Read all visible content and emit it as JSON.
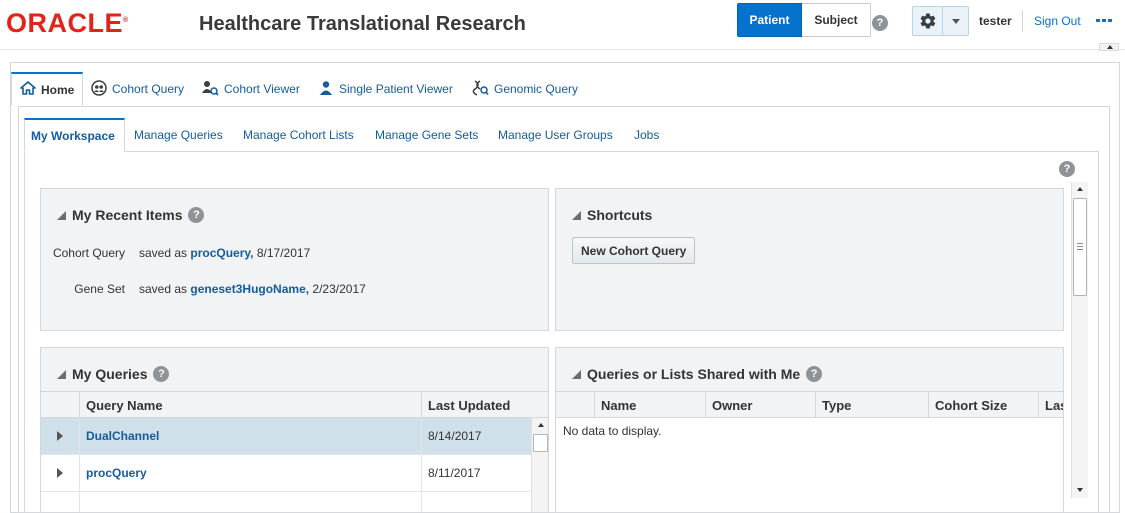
{
  "header": {
    "logo": "ORACLE",
    "title": "Healthcare Translational Research",
    "mode_patient": "Patient",
    "mode_subject": "Subject",
    "help": "?",
    "user": "tester",
    "sign_out": "Sign Out",
    "active_mode": "Patient"
  },
  "primary_tabs": [
    {
      "label": "Home",
      "icon": "home-icon",
      "active": true
    },
    {
      "label": "Cohort Query",
      "icon": "cohort-query-icon"
    },
    {
      "label": "Cohort Viewer",
      "icon": "cohort-viewer-icon"
    },
    {
      "label": "Single Patient Viewer",
      "icon": "single-patient-icon"
    },
    {
      "label": "Genomic Query",
      "icon": "genomic-query-icon"
    }
  ],
  "secondary_tabs": [
    {
      "label": "My Workspace",
      "active": true
    },
    {
      "label": "Manage Queries"
    },
    {
      "label": "Manage Cohort Lists"
    },
    {
      "label": "Manage Gene Sets"
    },
    {
      "label": "Manage User Groups"
    },
    {
      "label": "Jobs"
    }
  ],
  "recent_items": {
    "title": "My Recent Items",
    "rows": [
      {
        "type": "Cohort Query",
        "prefix": "saved as",
        "name": "procQuery,",
        "date": "8/17/2017"
      },
      {
        "type": "Gene Set",
        "prefix": "saved as",
        "name": "geneset3HugoName,",
        "date": "2/23/2017"
      }
    ]
  },
  "shortcuts": {
    "title": "Shortcuts",
    "new_cohort_query": "New Cohort Query"
  },
  "my_queries": {
    "title": "My Queries",
    "columns": [
      "Query Name",
      "Last Updated"
    ],
    "rows": [
      {
        "name": "DualChannel",
        "updated": "8/14/2017",
        "selected": true
      },
      {
        "name": "procQuery",
        "updated": "8/11/2017"
      }
    ]
  },
  "shared": {
    "title": "Queries or Lists Shared with Me",
    "columns": [
      "Name",
      "Owner",
      "Type",
      "Cohort Size",
      "Las"
    ],
    "empty_text": "No data to display."
  },
  "colors": {
    "accent": "#0572ce",
    "link": "#145c9e",
    "oracle_red": "#e2231a",
    "selected_row": "#cfe0ea"
  }
}
